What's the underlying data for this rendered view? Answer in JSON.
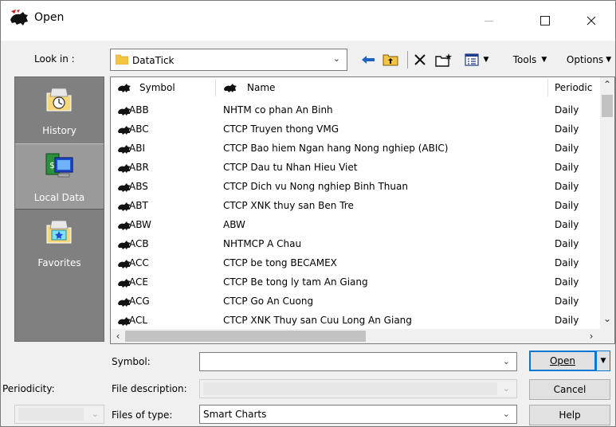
{
  "window": {
    "title": "Open"
  },
  "toolbar": {
    "lookin_label": "Look in :",
    "lookin_value": "DataTick",
    "tools_label": "Tools",
    "options_label": "Options"
  },
  "places": [
    {
      "label": "History",
      "icon": "history-icon"
    },
    {
      "label": "Local Data",
      "icon": "local-data-icon"
    },
    {
      "label": "Favorites",
      "icon": "favorites-icon"
    }
  ],
  "list": {
    "columns": [
      "Symbol",
      "Name",
      "Periodic"
    ],
    "rows": [
      {
        "symbol": "ABB",
        "name": "NHTM co phan An Binh",
        "periodicity": "Daily"
      },
      {
        "symbol": "ABC",
        "name": "CTCP Truyen thong VMG",
        "periodicity": "Daily"
      },
      {
        "symbol": "ABI",
        "name": "CTCP Bao hiem Ngan hang Nong nghiep (ABIC)",
        "periodicity": "Daily"
      },
      {
        "symbol": "ABR",
        "name": "CTCP Dau tu Nhan Hieu Viet",
        "periodicity": "Daily"
      },
      {
        "symbol": "ABS",
        "name": "CTCP Dich vu Nong nghiep Binh Thuan",
        "periodicity": "Daily"
      },
      {
        "symbol": "ABT",
        "name": "CTCP XNK thuy san Ben Tre",
        "periodicity": "Daily"
      },
      {
        "symbol": "ABW",
        "name": "ABW",
        "periodicity": "Daily"
      },
      {
        "symbol": "ACB",
        "name": "NHTMCP A Chau",
        "periodicity": "Daily"
      },
      {
        "symbol": "ACC",
        "name": "CTCP be tong BECAMEX",
        "periodicity": "Daily"
      },
      {
        "symbol": "ACE",
        "name": "CTCP Be tong ly tam An Giang",
        "periodicity": "Daily"
      },
      {
        "symbol": "ACG",
        "name": "CTCP Go An Cuong",
        "periodicity": "Daily"
      },
      {
        "symbol": "ACL",
        "name": "CTCP XNK Thuy san Cuu Long An Giang",
        "periodicity": "Daily"
      }
    ]
  },
  "form": {
    "symbol_label": "Symbol:",
    "symbol_value": "",
    "description_label": "File description:",
    "filetype_label": "Files of type:",
    "filetype_value": "Smart Charts",
    "periodicity_label": "Periodicity:"
  },
  "buttons": {
    "open": "Open",
    "cancel": "Cancel",
    "help": "Help"
  }
}
